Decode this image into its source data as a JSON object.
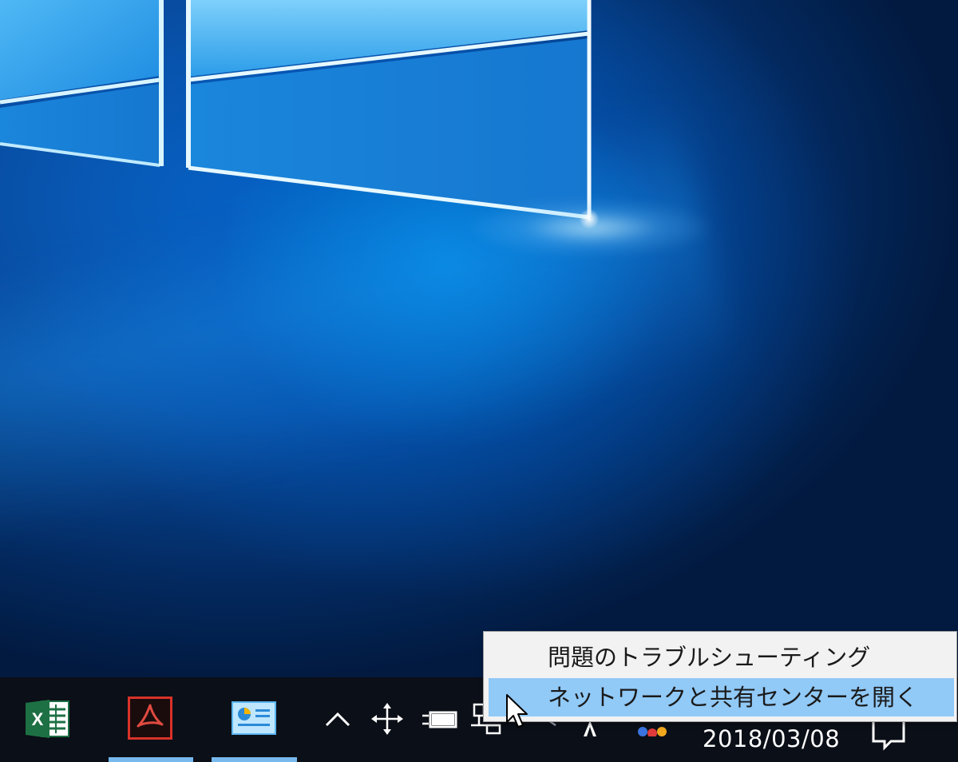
{
  "desktop": {
    "wallpaper": "windows-10-hero",
    "accent_color": "#0a63c4"
  },
  "taskbar": {
    "background": "#0b0f17",
    "apps": [
      {
        "name": "excel",
        "icon": "excel-icon",
        "running": false
      },
      {
        "name": "acrobat",
        "icon": "acrobat-icon",
        "running": true
      },
      {
        "name": "control-panel",
        "icon": "control-panel-icon",
        "running": true
      }
    ],
    "tray_icons": [
      "chevron-up-icon",
      "move-icon",
      "power-plug-icon",
      "network-icon",
      "ime-icon",
      "app-tray-icon"
    ],
    "clock": {
      "date": "2018/03/08"
    },
    "underline_color": "#76b9ed"
  },
  "context_menu": {
    "items": [
      {
        "label": "問題のトラブルシューティング",
        "highlighted": false
      },
      {
        "label": "ネットワークと共有センターを開く",
        "highlighted": true
      }
    ],
    "highlight_color": "#91c9f7"
  }
}
